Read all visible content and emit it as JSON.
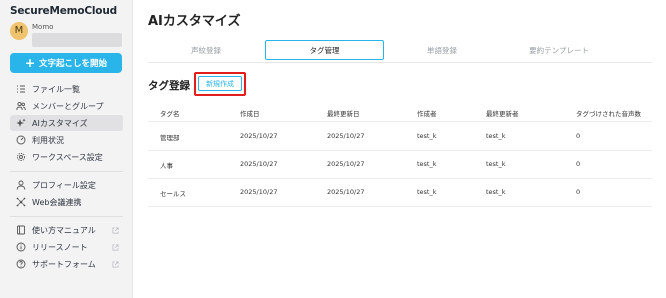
{
  "app": {
    "title": "SecureMemoCloud"
  },
  "user": {
    "initial": "M",
    "name": "Momo"
  },
  "sidebar": {
    "cta": {
      "icon": "plus-icon",
      "label": "文字起こしを開始"
    },
    "items": [
      {
        "label": "ファイル一覧",
        "icon": "list-icon"
      },
      {
        "label": "メンバーとグループ",
        "icon": "members-icon"
      },
      {
        "label": "AIカスタマイズ",
        "icon": "ai-sparkle-icon",
        "active": true
      },
      {
        "label": "利用状況",
        "icon": "gauge-icon"
      },
      {
        "label": "ワークスペース設定",
        "icon": "gear-icon"
      },
      {
        "label": "プロフィール設定",
        "icon": "person-icon"
      },
      {
        "label": "Web会議連携",
        "icon": "network-icon"
      },
      {
        "label": "使い方マニュアル",
        "icon": "book-icon",
        "external": true
      },
      {
        "label": "リリースノート",
        "icon": "info-icon",
        "external": true
      },
      {
        "label": "サポートフォーム",
        "icon": "help-icon",
        "external": true
      }
    ]
  },
  "main": {
    "title": "AIカスタマイズ",
    "tabs": [
      {
        "label": "声紋登録"
      },
      {
        "label": "タグ管理",
        "active": true
      },
      {
        "label": "単語登録"
      },
      {
        "label": "要約テンプレート"
      }
    ],
    "section": {
      "title": "タグ登録",
      "new_button": "新規作成"
    },
    "table": {
      "headers": [
        "タグ名",
        "作成日",
        "最終更新日",
        "作成者",
        "最終更新者",
        "タグづけされた音声数"
      ],
      "rows": [
        [
          "管理部",
          "2025/10/27",
          "2025/10/27",
          "test_k",
          "test_k",
          "0"
        ],
        [
          "人事",
          "2025/10/27",
          "2025/10/27",
          "test_k",
          "test_k",
          "0"
        ],
        [
          "セールス",
          "2025/10/27",
          "2025/10/27",
          "test_k",
          "test_k",
          "0"
        ]
      ]
    }
  },
  "colors": {
    "accent": "#29b5ea",
    "highlight": "#e11d1d",
    "sidebar_bg": "#f3f3f4"
  }
}
